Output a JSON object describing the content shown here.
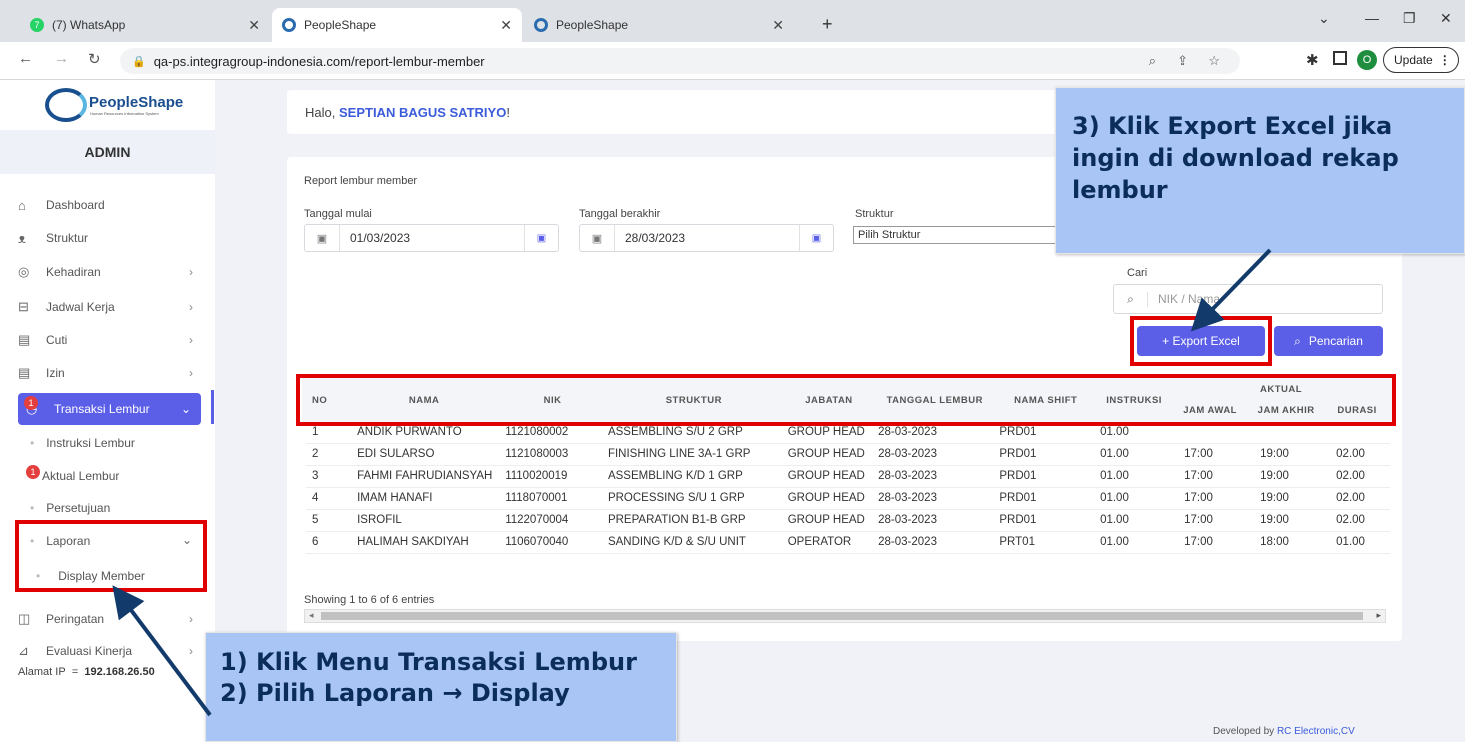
{
  "browser": {
    "tabs": [
      {
        "title": "(7) WhatsApp",
        "badge": "7"
      },
      {
        "title": "PeopleShape"
      },
      {
        "title": "PeopleShape"
      }
    ],
    "url": "qa-ps.integragroup-indonesia.com/report-lembur-member",
    "profile_initial": "O",
    "update_label": "Update"
  },
  "sidebar": {
    "logo_people": "People",
    "logo_shape": "Shape",
    "logo_sub": "Human Resources Information System",
    "role": "ADMIN",
    "items": [
      {
        "label": "Dashboard",
        "icon": "home-icon"
      },
      {
        "label": "Struktur",
        "icon": "org-icon"
      },
      {
        "label": "Kehadiran",
        "icon": "fingerprint-icon"
      },
      {
        "label": "Jadwal Kerja",
        "icon": "briefcase-icon"
      },
      {
        "label": "Cuti",
        "icon": "calendar-icon"
      },
      {
        "label": "Izin",
        "icon": "calendar-icon"
      },
      {
        "label": "Transaksi Lembur",
        "icon": "clock-icon",
        "badge": "1"
      },
      {
        "label": "Peringatan",
        "icon": "warning-icon"
      },
      {
        "label": "Evaluasi Kinerja",
        "icon": "chart-icon"
      }
    ],
    "sub_items": [
      {
        "label": "Instruksi Lembur"
      },
      {
        "label": "Aktual Lembur",
        "badge": "1"
      },
      {
        "label": "Persetujuan"
      },
      {
        "label": "Laporan"
      },
      {
        "label": "Display Member"
      }
    ],
    "ip_label": "Alamat IP",
    "ip_sep": "=",
    "ip_value": "192.168.26.50"
  },
  "greeting": {
    "prefix": "Halo,",
    "name": "SEPTIAN BAGUS SATRIYO",
    "suffix": "!"
  },
  "report": {
    "title": "Report lembur member",
    "start_label": "Tanggal mulai",
    "start_value": "01/03/2023",
    "end_label": "Tanggal berakhir",
    "end_value": "28/03/2023",
    "struktur_label": "Struktur",
    "struktur_value": "Pilih Struktur",
    "cari_label": "Cari",
    "search_placeholder": "NIK / Nama",
    "export_label": "+ Export Excel",
    "search_button": "Pencarian"
  },
  "table": {
    "headers": [
      "NO",
      "NAMA",
      "NIK",
      "STRUKTUR",
      "JABATAN",
      "TANGGAL LEMBUR",
      "NAMA SHIFT",
      "INSTRUKSI"
    ],
    "group_header": "AKTUAL",
    "sub_headers": [
      "JAM AWAL",
      "JAM AKHIR",
      "DURASI"
    ],
    "rows": [
      [
        "1",
        "ANDIK PURWANTO",
        "1121080002",
        "ASSEMBLING S/U 2 GRP",
        "GROUP HEAD",
        "28-03-2023",
        "PRD01",
        "01.00",
        "",
        "",
        ""
      ],
      [
        "2",
        "EDI SULARSO",
        "1121080003",
        "FINISHING LINE 3A-1 GRP",
        "GROUP HEAD",
        "28-03-2023",
        "PRD01",
        "01.00",
        "17:00",
        "19:00",
        "02.00"
      ],
      [
        "3",
        "FAHMI FAHRUDIANSYAH",
        "1110020019",
        "ASSEMBLING K/D 1 GRP",
        "GROUP HEAD",
        "28-03-2023",
        "PRD01",
        "01.00",
        "17:00",
        "19:00",
        "02.00"
      ],
      [
        "4",
        "IMAM HANAFI",
        "1118070001",
        "PROCESSING S/U 1 GRP",
        "GROUP HEAD",
        "28-03-2023",
        "PRD01",
        "01.00",
        "17:00",
        "19:00",
        "02.00"
      ],
      [
        "5",
        "ISROFIL",
        "1122070004",
        "PREPARATION B1-B GRP",
        "GROUP HEAD",
        "28-03-2023",
        "PRD01",
        "01.00",
        "17:00",
        "19:00",
        "02.00"
      ],
      [
        "6",
        "HALIMAH SAKDIYAH",
        "1106070040",
        "SANDING K/D & S/U UNIT",
        "OPERATOR",
        "28-03-2023",
        "PRT01",
        "01.00",
        "17:00",
        "18:00",
        "01.00"
      ]
    ],
    "info": "Showing 1 to 6 of 6 entries"
  },
  "footer": {
    "prefix": "Developed by",
    "company": "RC Electronic,CV"
  },
  "callouts": {
    "step3": "3) Klik Export Excel jika ingin di download rekap lembur",
    "step1": "1) Klik Menu Transaksi Lembur",
    "step2": "2) Pilih Laporan → Display"
  },
  "colors": {
    "accent": "#5b5fe8",
    "highlight": "#e00000",
    "callout": "#a9c5f5"
  }
}
